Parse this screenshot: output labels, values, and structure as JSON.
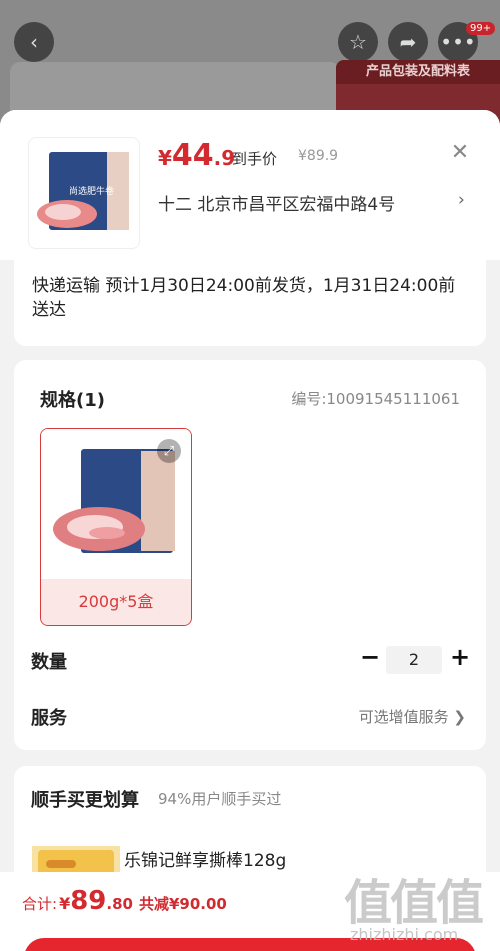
{
  "background": {
    "badge": "99+",
    "banner_label": "产品包装及配料表"
  },
  "header": {
    "price_currency": "¥",
    "price_int": "44",
    "price_dec": ".9",
    "price_tag": "到手价",
    "original_price": "¥89.9",
    "address": "十二  北京市昌平区宏福中路4号"
  },
  "shipping": {
    "text": "快递运输 预计1月30日24:00前发货，1月31日24:00前送达"
  },
  "spec": {
    "title": "规格(1)",
    "code": "编号:10091545111061",
    "options": [
      {
        "label": "200g*5盒",
        "product_text": "尚选肥牛卷"
      }
    ],
    "quantity_label": "数量",
    "quantity": "2",
    "service_label": "服务",
    "service_value": "可选增值服务 ❯"
  },
  "combo": {
    "title": "顺手买更划算",
    "subtitle": "94%用户顺手买过",
    "item_name": "乐锦记鲜享撕棒128g"
  },
  "footer": {
    "total_label": "合计:",
    "total_currency": "¥",
    "total_int": "89",
    "total_dec": ".80",
    "savings": "共减¥90.00"
  },
  "watermark": {
    "text": "zhizhizhi.com"
  },
  "colors": {
    "accent": "#d32a2f",
    "button": "#e6262f"
  }
}
